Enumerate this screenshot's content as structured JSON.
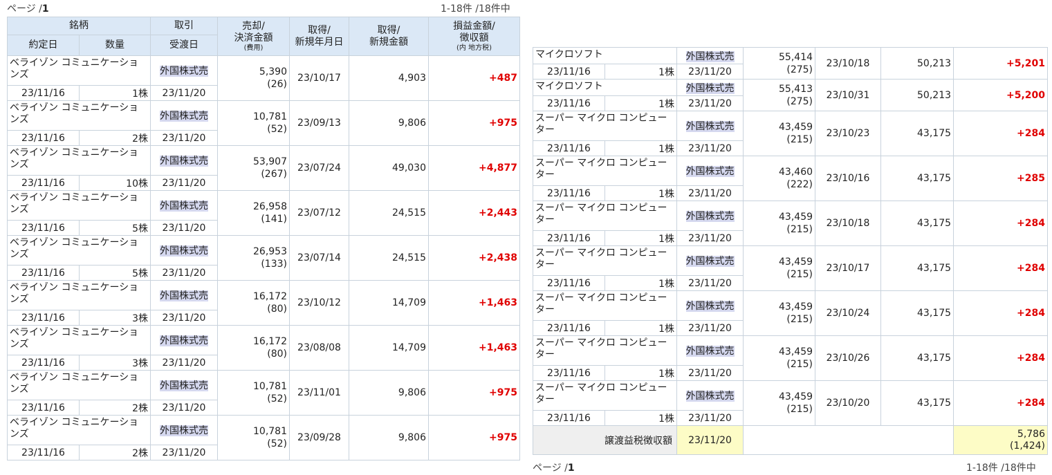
{
  "left_panel": {
    "page_label": "ページ /",
    "page_number": "1",
    "count_label": "1-18件 /18件中",
    "headers": {
      "brand": "銘柄",
      "trade": "取引",
      "sell_amount_line1": "売却/",
      "sell_amount_line2": "決済金額",
      "sell_amount_sub": "(費用)",
      "acq_date_line1": "取得/",
      "acq_date_line2": "新規年月日",
      "acq_amount_line1": "取得/",
      "acq_amount_line2": "新規金額",
      "pl_line1": "損益金額/",
      "pl_line2": "徴収額",
      "pl_sub": "(内 地方税)",
      "contract_date": "約定日",
      "quantity": "数量",
      "delivery_date": "受渡日"
    },
    "rows": [
      {
        "name": "ベライゾン コミュニケーションズ",
        "trade_type": "外国株式売",
        "contract_date": "23/11/16",
        "qty": "1株",
        "delivery_date": "23/11/20",
        "sell_amount": "5,390",
        "fee": "(26)",
        "acq_date": "23/10/17",
        "acq_amount": "4,903",
        "pl": "+487"
      },
      {
        "name": "ベライゾン コミュニケーションズ",
        "trade_type": "外国株式売",
        "contract_date": "23/11/16",
        "qty": "2株",
        "delivery_date": "23/11/20",
        "sell_amount": "10,781",
        "fee": "(52)",
        "acq_date": "23/09/13",
        "acq_amount": "9,806",
        "pl": "+975"
      },
      {
        "name": "ベライゾン コミュニケーションズ",
        "trade_type": "外国株式売",
        "contract_date": "23/11/16",
        "qty": "10株",
        "delivery_date": "23/11/20",
        "sell_amount": "53,907",
        "fee": "(267)",
        "acq_date": "23/07/24",
        "acq_amount": "49,030",
        "pl": "+4,877"
      },
      {
        "name": "ベライゾン コミュニケーションズ",
        "trade_type": "外国株式売",
        "contract_date": "23/11/16",
        "qty": "5株",
        "delivery_date": "23/11/20",
        "sell_amount": "26,958",
        "fee": "(141)",
        "acq_date": "23/07/12",
        "acq_amount": "24,515",
        "pl": "+2,443"
      },
      {
        "name": "ベライゾン コミュニケーションズ",
        "trade_type": "外国株式売",
        "contract_date": "23/11/16",
        "qty": "5株",
        "delivery_date": "23/11/20",
        "sell_amount": "26,953",
        "fee": "(133)",
        "acq_date": "23/07/14",
        "acq_amount": "24,515",
        "pl": "+2,438"
      },
      {
        "name": "ベライゾン コミュニケーションズ",
        "trade_type": "外国株式売",
        "contract_date": "23/11/16",
        "qty": "3株",
        "delivery_date": "23/11/20",
        "sell_amount": "16,172",
        "fee": "(80)",
        "acq_date": "23/10/12",
        "acq_amount": "14,709",
        "pl": "+1,463"
      },
      {
        "name": "ベライゾン コミュニケーションズ",
        "trade_type": "外国株式売",
        "contract_date": "23/11/16",
        "qty": "3株",
        "delivery_date": "23/11/20",
        "sell_amount": "16,172",
        "fee": "(80)",
        "acq_date": "23/08/08",
        "acq_amount": "14,709",
        "pl": "+1,463"
      },
      {
        "name": "ベライゾン コミュニケーションズ",
        "trade_type": "外国株式売",
        "contract_date": "23/11/16",
        "qty": "2株",
        "delivery_date": "23/11/20",
        "sell_amount": "10,781",
        "fee": "(52)",
        "acq_date": "23/11/01",
        "acq_amount": "9,806",
        "pl": "+975"
      },
      {
        "name": "ベライゾン コミュニケーションズ",
        "trade_type": "外国株式売",
        "contract_date": "23/11/16",
        "qty": "2株",
        "delivery_date": "23/11/20",
        "sell_amount": "10,781",
        "fee": "(52)",
        "acq_date": "23/09/28",
        "acq_amount": "9,806",
        "pl": "+975"
      }
    ]
  },
  "right_panel": {
    "page_label": "ページ /",
    "page_number": "1",
    "count_label": "1-18件 /18件中",
    "rows": [
      {
        "name": "マイクロソフト",
        "trade_type": "外国株式売",
        "contract_date": "23/11/16",
        "qty": "1株",
        "delivery_date": "23/11/20",
        "sell_amount": "55,414",
        "fee": "(275)",
        "acq_date": "23/10/18",
        "acq_amount": "50,213",
        "pl": "+5,201"
      },
      {
        "name": "マイクロソフト",
        "trade_type": "外国株式売",
        "contract_date": "23/11/16",
        "qty": "1株",
        "delivery_date": "23/11/20",
        "sell_amount": "55,413",
        "fee": "(275)",
        "acq_date": "23/10/31",
        "acq_amount": "50,213",
        "pl": "+5,200"
      },
      {
        "name": "スーパー マイクロ コンピューター",
        "trade_type": "外国株式売",
        "contract_date": "23/11/16",
        "qty": "1株",
        "delivery_date": "23/11/20",
        "sell_amount": "43,459",
        "fee": "(215)",
        "acq_date": "23/10/23",
        "acq_amount": "43,175",
        "pl": "+284"
      },
      {
        "name": "スーパー マイクロ コンピューター",
        "trade_type": "外国株式売",
        "contract_date": "23/11/16",
        "qty": "1株",
        "delivery_date": "23/11/20",
        "sell_amount": "43,460",
        "fee": "(222)",
        "acq_date": "23/10/16",
        "acq_amount": "43,175",
        "pl": "+285"
      },
      {
        "name": "スーパー マイクロ コンピューター",
        "trade_type": "外国株式売",
        "contract_date": "23/11/16",
        "qty": "1株",
        "delivery_date": "23/11/20",
        "sell_amount": "43,459",
        "fee": "(215)",
        "acq_date": "23/10/18",
        "acq_amount": "43,175",
        "pl": "+284"
      },
      {
        "name": "スーパー マイクロ コンピューター",
        "trade_type": "外国株式売",
        "contract_date": "23/11/16",
        "qty": "1株",
        "delivery_date": "23/11/20",
        "sell_amount": "43,459",
        "fee": "(215)",
        "acq_date": "23/10/17",
        "acq_amount": "43,175",
        "pl": "+284"
      },
      {
        "name": "スーパー マイクロ コンピューター",
        "trade_type": "外国株式売",
        "contract_date": "23/11/16",
        "qty": "1株",
        "delivery_date": "23/11/20",
        "sell_amount": "43,459",
        "fee": "(215)",
        "acq_date": "23/10/24",
        "acq_amount": "43,175",
        "pl": "+284"
      },
      {
        "name": "スーパー マイクロ コンピューター",
        "trade_type": "外国株式売",
        "contract_date": "23/11/16",
        "qty": "1株",
        "delivery_date": "23/11/20",
        "sell_amount": "43,459",
        "fee": "(215)",
        "acq_date": "23/10/26",
        "acq_amount": "43,175",
        "pl": "+284"
      },
      {
        "name": "スーパー マイクロ コンピューター",
        "trade_type": "外国株式売",
        "contract_date": "23/11/16",
        "qty": "1株",
        "delivery_date": "23/11/20",
        "sell_amount": "43,459",
        "fee": "(215)",
        "acq_date": "23/10/20",
        "acq_amount": "43,175",
        "pl": "+284"
      }
    ],
    "tax_row": {
      "label": "譲渡益税徴収額",
      "date": "23/11/20",
      "amount": "5,786",
      "local_tax": "(1,424)"
    }
  },
  "colors": {
    "header_bg": "#dbe8f6",
    "trade_badge_bg": "#d5d8ef",
    "profit_red": "#e00000",
    "tax_highlight": "#fdfcc6",
    "border": "#c8d2dc"
  }
}
